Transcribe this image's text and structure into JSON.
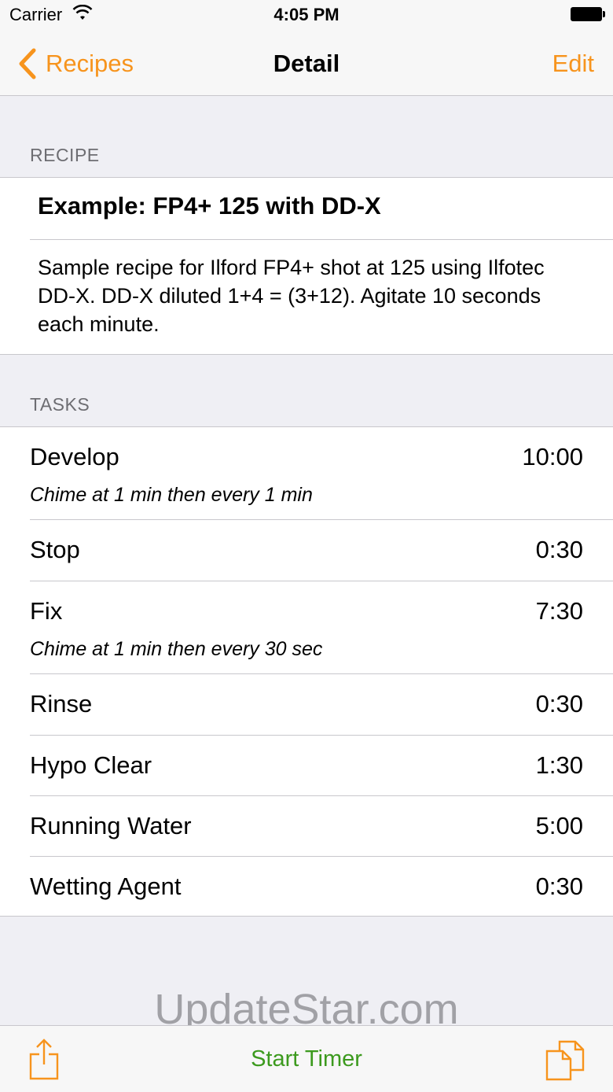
{
  "status_bar": {
    "carrier": "Carrier",
    "time": "4:05 PM"
  },
  "nav": {
    "back_label": "Recipes",
    "title": "Detail",
    "edit_label": "Edit"
  },
  "recipe_section": {
    "header": "RECIPE",
    "title": "Example: FP4+ 125 with DD-X",
    "description": "Sample recipe for Ilford FP4+ shot at 125 using Ilfotec DD-X. DD-X diluted 1+4 = (3+12). Agitate 10 seconds each minute."
  },
  "tasks_section": {
    "header": "TASKS",
    "tasks": [
      {
        "name": "Develop",
        "time": "10:00",
        "subtitle": "Chime at 1 min then every 1 min"
      },
      {
        "name": "Stop",
        "time": "0:30"
      },
      {
        "name": "Fix",
        "time": "7:30",
        "subtitle": "Chime at 1 min then every 30 sec"
      },
      {
        "name": "Rinse",
        "time": "0:30"
      },
      {
        "name": "Hypo Clear",
        "time": "1:30"
      },
      {
        "name": "Running Water",
        "time": "5:00"
      },
      {
        "name": "Wetting Agent",
        "time": "0:30"
      }
    ]
  },
  "watermark": "UpdateStar.com",
  "toolbar": {
    "start_label": "Start Timer"
  },
  "icons": {
    "back": "chevron-left-icon",
    "share": "share-icon",
    "copy": "copy-icon",
    "wifi": "wifi-icon",
    "battery": "battery-icon"
  },
  "colors": {
    "accent": "#f7941d",
    "start_timer": "#3c9a1e",
    "background": "#efeff4"
  }
}
